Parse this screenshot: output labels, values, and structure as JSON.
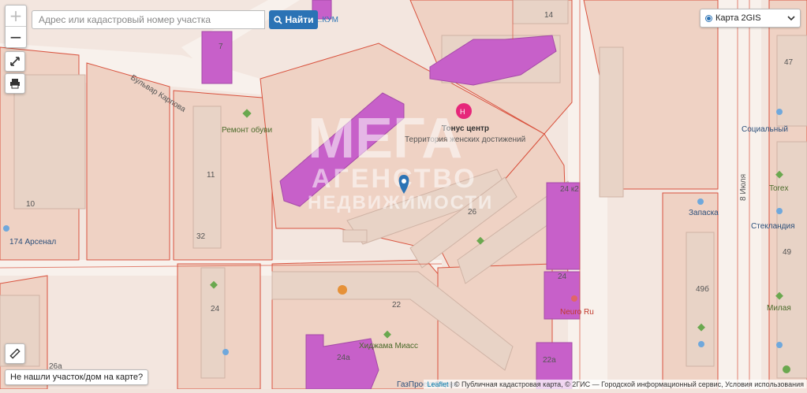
{
  "search": {
    "placeholder": "Адрес или кадастровый номер участка",
    "button_label": "Найти"
  },
  "zoom": {
    "in": "+",
    "out": "−"
  },
  "layer_select": {
    "selected": "Карта 2GIS"
  },
  "not_found_label": "Не нашли участок/дом на карте?",
  "attribution": {
    "leaflet": "Leaflet",
    "text": "| © Публичная кадастровая карта, © 2ГИС — Городской информационный сервис, Условия использования"
  },
  "watermark": {
    "line1": "МЕГА",
    "line2": "АГЕНСТВО",
    "line3": "НЕДВИЖИМОСТИ"
  },
  "map": {
    "streets": [
      "Бульвар Карпова",
      "8 Июля"
    ],
    "houses": [
      "14",
      "47",
      "10",
      "11",
      "32",
      "26",
      "24 к2",
      "24",
      "49",
      "49б",
      "24",
      "22",
      "26а",
      "24а",
      "22а",
      "7"
    ],
    "pois": [
      "Тонус центр",
      "Территория женских достижений",
      "Ремонт обуви",
      "174 Арсенал",
      "Социальный",
      "Torex",
      "Запаска",
      "Стекландия",
      "Милая",
      "Neuro Ru",
      "Хиджама Миасс",
      "ГазПроектСерви",
      "...КУМ"
    ],
    "colors": {
      "parcel_fill": "#f0d5c8",
      "parcel_border": "#d9533f",
      "building": "#ead6c9",
      "highlight": "#c45cc8",
      "road": "#f7efe9"
    }
  }
}
